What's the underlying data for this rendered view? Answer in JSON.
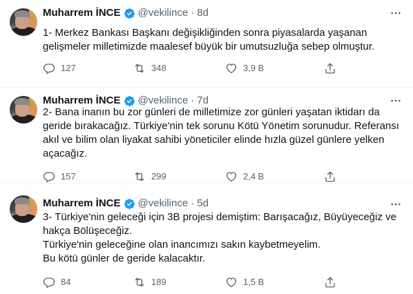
{
  "tweets": [
    {
      "name": "Muharrem İNCE",
      "handle": "@vekilince",
      "dot": "·",
      "time": "8d",
      "lines": [
        "1- Merkez Bankası Başkanı değişikliğinden sonra piyasalarda yaşanan",
        "gelişmeler milletimizde maalesef büyük bir umutsuzluğa sebep olmuştur."
      ],
      "replies": "127",
      "retweets": "348",
      "likes": "3,9 B"
    },
    {
      "name": "Muharrem İNCE",
      "handle": "@vekilince",
      "dot": "·",
      "time": "7d",
      "lines": [
        "2- Bana inanın bu zor günleri de milletimize zor günleri yaşatan iktidarı da",
        "geride bırakacağız. Türkiye'nin tek sorunu Kötü Yönetim sorunudur. Referansı",
        "akıl ve bilim olan liyakat sahibi yöneticiler elinde hızla güzel günlere yelken",
        "açacağız."
      ],
      "replies": "157",
      "retweets": "299",
      "likes": "2,4 B"
    },
    {
      "name": "Muharrem İNCE",
      "handle": "@vekilince",
      "dot": "·",
      "time": "5d",
      "lines": [
        "3- Türkiye'nin geleceği için 3B projesi demiştim: Barışacağız, Büyüyeceğiz ve",
        "hakça Bölüşeceğiz.",
        "Türkiye'nin geleceğine olan inancımızı sakın kaybetmeyelim.",
        "Bu kötü günler de geride kalacaktır."
      ],
      "replies": "84",
      "retweets": "189",
      "likes": "1,5 B"
    }
  ],
  "colors": {
    "text": "#0f1419",
    "muted": "#536471",
    "verified": "#1d9bf0",
    "border": "#eff3f4"
  },
  "icons": [
    "verified-badge-icon",
    "more-icon",
    "reply-icon",
    "retweet-icon",
    "like-icon",
    "share-icon"
  ]
}
